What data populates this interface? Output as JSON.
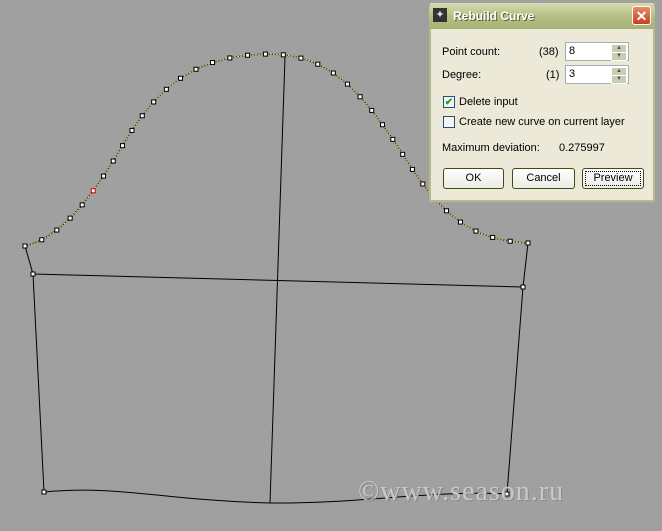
{
  "dialog": {
    "title": "Rebuild Curve",
    "point_count_label": "Point count:",
    "point_count_current": "(38)",
    "point_count_value": "8",
    "degree_label": "Degree:",
    "degree_current": "(1)",
    "degree_value": "3",
    "delete_input_label": "Delete input",
    "delete_input_checked": true,
    "create_new_label": "Create new curve on current layer",
    "create_new_checked": false,
    "max_dev_label": "Maximum deviation:",
    "max_dev_value": "0.275997",
    "ok": "OK",
    "cancel": "Cancel",
    "preview": "Preview",
    "close": "✕"
  },
  "viewport": {
    "control_point_count": 38,
    "curve_color": "#e8e070"
  },
  "watermark": "©www.season.ru"
}
